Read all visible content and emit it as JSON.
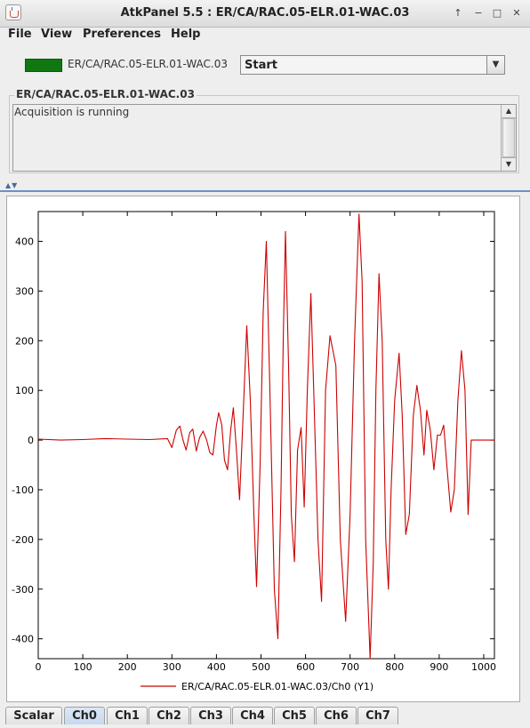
{
  "window": {
    "title": "AtkPanel  5.5  : ER/CA/RAC.05-ELR.01-WAC.03",
    "controls": [
      "↑",
      "−",
      "□",
      "✕"
    ]
  },
  "menu": [
    "File",
    "View",
    "Preferences",
    "Help"
  ],
  "device": {
    "state_color": "#117711",
    "name": "ER/CA/RAC.05-ELR.01-WAC.03",
    "command_selected": "Start"
  },
  "status": {
    "title": "ER/CA/RAC.05-ELR.01-WAC.03",
    "text": "Acquisition is running"
  },
  "chart_data": {
    "type": "line",
    "title": "",
    "xlabel": "",
    "ylabel": "",
    "xlim": [
      0,
      1024
    ],
    "ylim": [
      -440,
      460
    ],
    "xticks": [
      0,
      100,
      200,
      300,
      400,
      500,
      600,
      700,
      800,
      900,
      1000
    ],
    "yticks": [
      -400,
      -300,
      -200,
      -100,
      0,
      100,
      200,
      300,
      400
    ],
    "grid": false,
    "legend": "bottom-center",
    "series": [
      {
        "name": "ER/CA/RAC.05-ELR.01-WAC.03/Ch0 (Y1)",
        "color": "#cc0000",
        "x": [
          0,
          50,
          100,
          150,
          200,
          250,
          290,
          300,
          310,
          318,
          325,
          332,
          340,
          347,
          355,
          362,
          370,
          378,
          385,
          392,
          400,
          405,
          412,
          418,
          425,
          432,
          438,
          445,
          452,
          460,
          468,
          476,
          484,
          490,
          498,
          505,
          512,
          520,
          530,
          538,
          545,
          550,
          555,
          562,
          568,
          575,
          582,
          590,
          597,
          604,
          612,
          620,
          628,
          636,
          645,
          655,
          668,
          678,
          690,
          700,
          710,
          720,
          727,
          735,
          745,
          752,
          758,
          765,
          772,
          780,
          786,
          792,
          800,
          810,
          817,
          825,
          833,
          842,
          850,
          858,
          866,
          872,
          880,
          888,
          896,
          903,
          910,
          918,
          926,
          934,
          942,
          950,
          958,
          965,
          972,
          980,
          986,
          992,
          1000,
          1008,
          1016,
          1024
        ],
        "y": [
          2,
          0,
          1,
          3,
          2,
          1,
          3,
          -15,
          20,
          28,
          0,
          -20,
          15,
          22,
          -22,
          5,
          18,
          0,
          -25,
          -30,
          30,
          55,
          30,
          -40,
          -60,
          20,
          65,
          -20,
          -120,
          50,
          230,
          80,
          -150,
          -295,
          -50,
          260,
          400,
          100,
          -300,
          -400,
          -100,
          200,
          420,
          150,
          -150,
          -245,
          -20,
          25,
          -135,
          100,
          295,
          50,
          -200,
          -325,
          100,
          210,
          150,
          -200,
          -365,
          -150,
          200,
          455,
          320,
          -200,
          -440,
          -250,
          100,
          335,
          200,
          -200,
          -300,
          -100,
          80,
          175,
          50,
          -190,
          -150,
          50,
          110,
          60,
          -30,
          60,
          20,
          -60,
          10,
          10,
          30,
          -60,
          -145,
          -100,
          80,
          180,
          100,
          -150,
          0,
          0,
          0,
          0,
          0,
          0,
          0,
          0
        ]
      }
    ]
  },
  "tabs": [
    "Scalar",
    "Ch0",
    "Ch1",
    "Ch2",
    "Ch3",
    "Ch4",
    "Ch5",
    "Ch6",
    "Ch7"
  ],
  "selected_tab": "Ch0"
}
